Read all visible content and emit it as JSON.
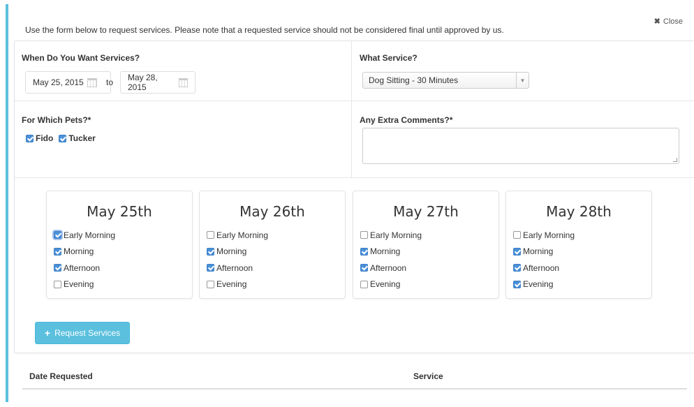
{
  "intro_text": "Use the form below to request services. Please note that a requested service should not be considered final until approved by us.",
  "close_label": "Close",
  "when": {
    "label": "When Do You Want Services?",
    "start_date": "May 25, 2015",
    "to_label": "to",
    "end_date": "May 28, 2015"
  },
  "service": {
    "label": "What Service?",
    "selected": "Dog Sitting - 30 Minutes"
  },
  "pets": {
    "label": "For Which Pets?*",
    "items": [
      {
        "name": "Fido",
        "checked": true
      },
      {
        "name": "Tucker",
        "checked": true
      }
    ]
  },
  "comments": {
    "label": "Any Extra Comments?*",
    "value": ""
  },
  "days": [
    {
      "title": "May 25th",
      "slots": [
        {
          "label": "Early Morning",
          "checked": true
        },
        {
          "label": "Morning",
          "checked": true
        },
        {
          "label": "Afternoon",
          "checked": true
        },
        {
          "label": "Evening",
          "checked": false
        }
      ]
    },
    {
      "title": "May 26th",
      "slots": [
        {
          "label": "Early Morning",
          "checked": false
        },
        {
          "label": "Morning",
          "checked": true
        },
        {
          "label": "Afternoon",
          "checked": true
        },
        {
          "label": "Evening",
          "checked": false
        }
      ]
    },
    {
      "title": "May 27th",
      "slots": [
        {
          "label": "Early Morning",
          "checked": false
        },
        {
          "label": "Morning",
          "checked": true
        },
        {
          "label": "Afternoon",
          "checked": true
        },
        {
          "label": "Evening",
          "checked": false
        }
      ]
    },
    {
      "title": "May 28th",
      "slots": [
        {
          "label": "Early Morning",
          "checked": false
        },
        {
          "label": "Morning",
          "checked": true
        },
        {
          "label": "Afternoon",
          "checked": true
        },
        {
          "label": "Evening",
          "checked": true
        }
      ]
    }
  ],
  "request_button": "Request Services",
  "table": {
    "headers": [
      "Date Requested",
      "Service"
    ]
  }
}
